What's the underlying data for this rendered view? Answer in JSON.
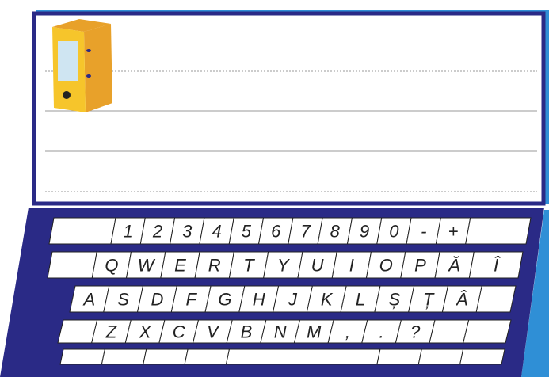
{
  "colors": {
    "frame_blue": "#2a2a86",
    "frame_shadow": "#2f8fd6",
    "folder_yellow": "#f6c52b",
    "folder_shadow": "#e8a12a",
    "folder_window": "#cfe5f2",
    "key_fill": "#ffffff",
    "key_border": "#222222",
    "rule_line": "#9a9a9a"
  },
  "screen": {
    "icon": "folder-binder-icon"
  },
  "keyboard": {
    "rows": [
      [
        "",
        "1",
        "2",
        "3",
        "4",
        "5",
        "6",
        "7",
        "8",
        "9",
        "0",
        "-",
        "+",
        ""
      ],
      [
        "",
        "Q",
        "W",
        "E",
        "R",
        "T",
        "Y",
        "U",
        "I",
        "O",
        "P",
        "Ă",
        "Î"
      ],
      [
        "A",
        "S",
        "D",
        "F",
        "G",
        "H",
        "J",
        "K",
        "L",
        "Ș",
        "Ț",
        "Â",
        ""
      ],
      [
        "",
        "Z",
        "X",
        "C",
        "V",
        "B",
        "N",
        "M",
        ",",
        ".",
        "?",
        "",
        ""
      ],
      [
        "",
        "",
        "",
        "",
        "",
        "",
        "",
        ""
      ]
    ]
  }
}
